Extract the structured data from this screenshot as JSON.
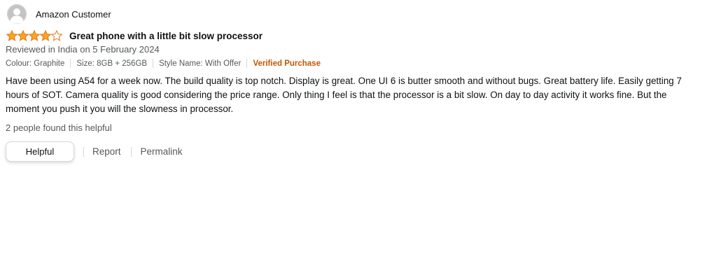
{
  "reviewer": {
    "name": "Amazon Customer",
    "avatar_icon": "user-silhouette-icon"
  },
  "review": {
    "rating": 4,
    "rating_max": 5,
    "title": "Great phone with a little bit slow processor",
    "date_line": "Reviewed in India on 5 February 2024",
    "variant": {
      "colour": "Colour: Graphite",
      "size": "Size: 8GB + 256GB",
      "style": "Style Name: With Offer",
      "verified": "Verified Purchase"
    },
    "body": "Have been using A54 for a week now. The build quality is top notch. Display is great. One UI 6 is butter smooth and without bugs. Great battery life. Easily getting 7 hours of SOT. Camera quality is good considering the price range. Only thing I feel is that the processor is a bit slow. On day to day activity it works fine. But the moment you push it you will the slowness in processor.",
    "helpful_count": "2 people found this helpful"
  },
  "actions": {
    "helpful_label": "Helpful",
    "report_label": "Report",
    "permalink_label": "Permalink"
  },
  "colors": {
    "star": "#ffa41c",
    "star_outline": "#de7921",
    "verified": "#c45500",
    "secondary_text": "#565959"
  }
}
